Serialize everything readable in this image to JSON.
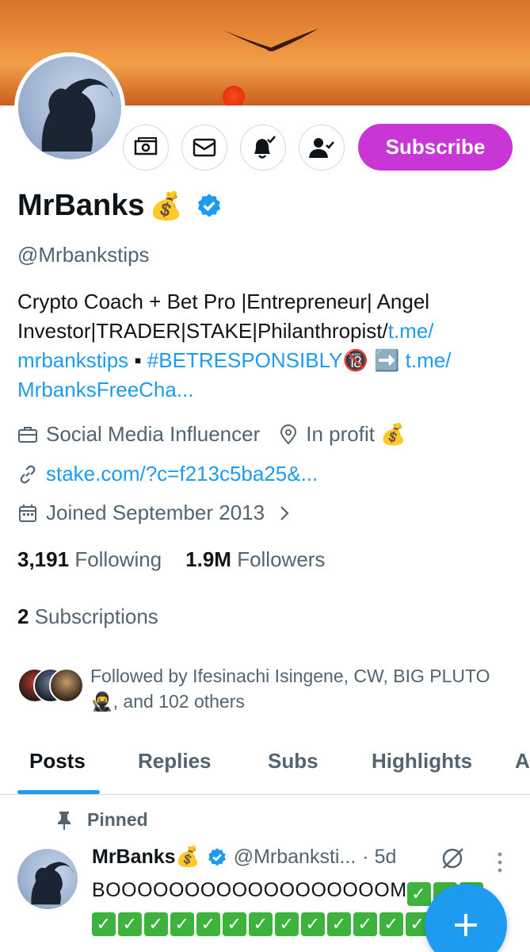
{
  "profile": {
    "name": "MrBanks",
    "name_emoji": "💰",
    "handle": "@Mrbankstips",
    "subscribe_label": "Subscribe",
    "bio_text_1": "Crypto Coach + Bet Pro |Entrepreneur| Angel Investor|TRADER|STAKE|Philanthropist/",
    "bio_link_1": "t.me/\nmrbankstips",
    "bio_sep": " ▪ ",
    "bio_hashtag": "#BETRESPONSIBLY",
    "bio_badge": "🔞",
    "bio_arrow": " ➡️ ",
    "bio_link_2": "t.me/\nMrbanksFreeCha...",
    "category": "Social Media Influencer",
    "location": "In profit 💰",
    "website": "stake.com/?c=f213c5ba25&...",
    "joined": "Joined September 2013"
  },
  "stats": {
    "following_count": "3,191",
    "following_label": "Following",
    "followers_count": "1.9M",
    "followers_label": "Followers",
    "subscriptions_count": "2",
    "subscriptions_label": "Subscriptions"
  },
  "followed_by": "Followed by Ifesinachi Isingene, CW, BIG PLUTO 🥷, and 102 others",
  "tabs": [
    "Posts",
    "Replies",
    "Subs",
    "Highlights",
    "A"
  ],
  "pinned": {
    "label": "Pinned",
    "author_name": "MrBanks💰",
    "author_handle": "@Mrbanksti...",
    "time": "· 5d",
    "text": "BOOOOOOOOOOOOOOOOOOM",
    "check_count_line1": 3,
    "check_count_line2": 13
  },
  "colors": {
    "accent": "#1d9bf0",
    "subscribe": "#c936d6",
    "secondary_text": "#536471"
  },
  "icons": [
    "money-icon",
    "mail-icon",
    "bell-check-icon",
    "follow-check-icon",
    "verified-icon",
    "briefcase-icon",
    "location-icon",
    "link-icon",
    "calendar-icon",
    "chevron-right-icon",
    "pin-icon",
    "grok-icon",
    "more-icon",
    "plus-icon"
  ]
}
